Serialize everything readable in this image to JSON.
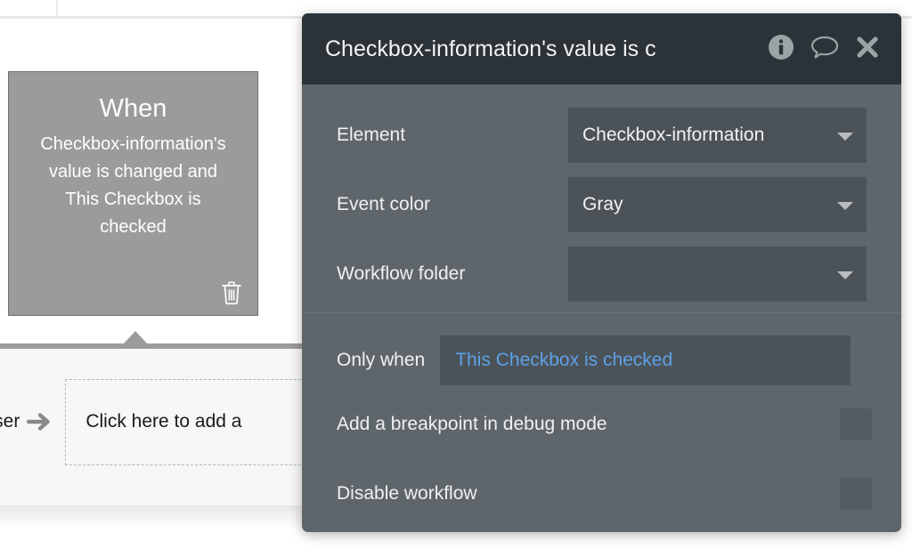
{
  "canvas": {
    "event_card": {
      "title": "When",
      "description": "Checkbox-information's value is changed and This Checkbox is checked",
      "delete_icon": "trash-icon",
      "background_color": "#9b9b9b",
      "border_color": "#6f6f6f"
    },
    "action_panel": {
      "preceding_label": "User",
      "arrow_icon": "arrow-right-icon",
      "add_action_placeholder": "Click here to add a"
    }
  },
  "dialog": {
    "title": "Checkbox-information's value is c",
    "header_icons": [
      {
        "name": "info-icon",
        "glyph": "i"
      },
      {
        "name": "comment-icon",
        "glyph": "speech-bubble"
      },
      {
        "name": "close-icon",
        "glyph": "x"
      }
    ],
    "header_color": "#2b3338",
    "body_color": "#5f666b",
    "field_color": "#4c5358",
    "accent_color": "#5ca0e8",
    "fields": [
      {
        "label": "Element",
        "value": "Checkbox-information",
        "has_caret": true
      },
      {
        "label": "Event color",
        "value": "Gray",
        "has_caret": true
      },
      {
        "label": "Workflow folder",
        "value": "",
        "has_caret": true
      }
    ],
    "only_when": {
      "label": "Only when",
      "value": "This Checkbox is checked"
    },
    "checkboxes": [
      {
        "label": "Add a breakpoint in debug mode",
        "checked": false
      },
      {
        "label": "Disable workflow",
        "checked": false
      }
    ]
  }
}
